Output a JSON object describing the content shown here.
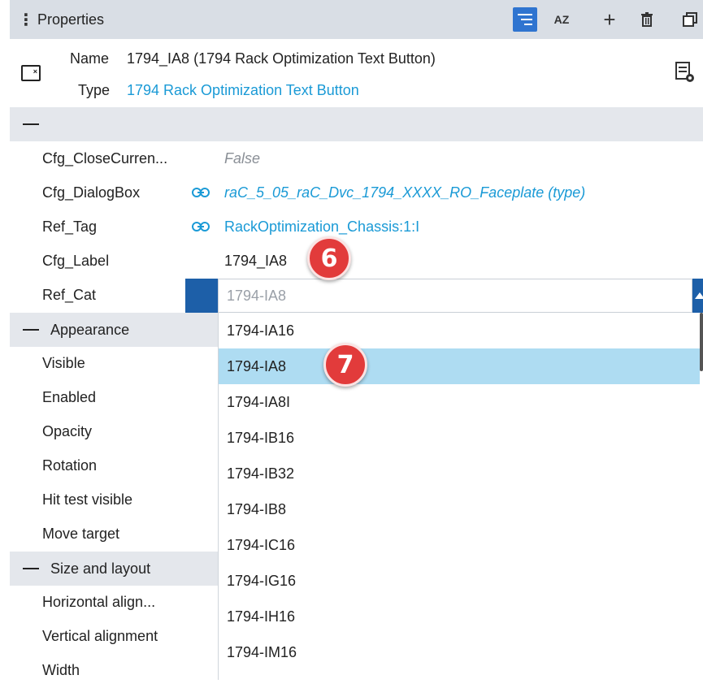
{
  "panel": {
    "title": "Properties",
    "toolbar": {
      "categorize_icon": "categorize-icon",
      "sort_az_label": "AZ",
      "add_icon": "plus-icon",
      "delete_icon": "trash-icon",
      "copy_icon": "copy-icon",
      "accent": "#2f74d0"
    }
  },
  "header": {
    "name_label": "Name",
    "name_value": "1794_IA8 (1794 Rack Optimization Text Button)",
    "type_label": "Type",
    "type_value": "1794 Rack Optimization Text Button"
  },
  "properties": [
    {
      "name": "Cfg_CloseCurren...",
      "value": "False"
    },
    {
      "name": "Cfg_DialogBox",
      "value": "raC_5_05_raC_Dvc_1794_XXXX_RO_Faceplate (type)"
    },
    {
      "name": "Ref_Tag",
      "value": "RackOptimization_Chassis:1:I"
    },
    {
      "name": "Cfg_Label",
      "value": "1794_IA8"
    },
    {
      "name": "Ref_Cat",
      "value": "1794-IA8"
    }
  ],
  "appearance": {
    "title": "Appearance",
    "items": [
      "Visible",
      "Enabled",
      "Opacity",
      "Rotation",
      "Hit test visible",
      "Move target"
    ]
  },
  "size_layout": {
    "title": "Size and layout",
    "items": [
      "Horizontal align...",
      "Vertical alignment",
      "Width"
    ]
  },
  "dropdown": {
    "options": [
      "1794-IA16",
      "1794-IA8",
      "1794-IA8I",
      "1794-IB16",
      "1794-IB32",
      "1794-IB8",
      "1794-IC16",
      "1794-IG16",
      "1794-IH16",
      "1794-IM16"
    ],
    "selected": "1794-IA8",
    "highlight": "#aedcf2"
  },
  "annotations": {
    "step6": "6",
    "step7": "7",
    "color": "#e23b3b"
  }
}
